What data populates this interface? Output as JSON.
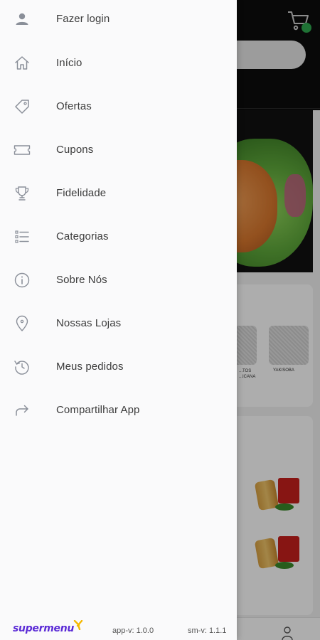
{
  "drawer": {
    "menu": [
      {
        "label": "Fazer login",
        "icon": "user-icon"
      },
      {
        "label": "Início",
        "icon": "home-icon"
      },
      {
        "label": "Ofertas",
        "icon": "tag-icon"
      },
      {
        "label": "Cupons",
        "icon": "ticket-icon"
      },
      {
        "label": "Fidelidade",
        "icon": "trophy-icon"
      },
      {
        "label": "Categorias",
        "icon": "list-icon"
      },
      {
        "label": "Sobre Nós",
        "icon": "info-icon"
      },
      {
        "label": "Nossas Lojas",
        "icon": "location-pin-icon"
      },
      {
        "label": "Meus pedidos",
        "icon": "history-icon"
      },
      {
        "label": "Compartilhar App",
        "icon": "share-icon"
      }
    ],
    "footer": {
      "brand": "supermenu",
      "app_version": "app-v: 1.0.0",
      "sm_version": "sm-v: 1.1.1"
    }
  },
  "background": {
    "category_labels": [
      "...TOS ...ICANA",
      "YAKISOBA"
    ],
    "cart_icon": "cart-icon",
    "profile_icon": "user-icon"
  },
  "colors": {
    "brand": "#5b2bd6",
    "brand_accent": "#f5b800",
    "icon": "#8a8f99",
    "text": "#3c3c3c",
    "cart_badge": "#2fa84f"
  }
}
